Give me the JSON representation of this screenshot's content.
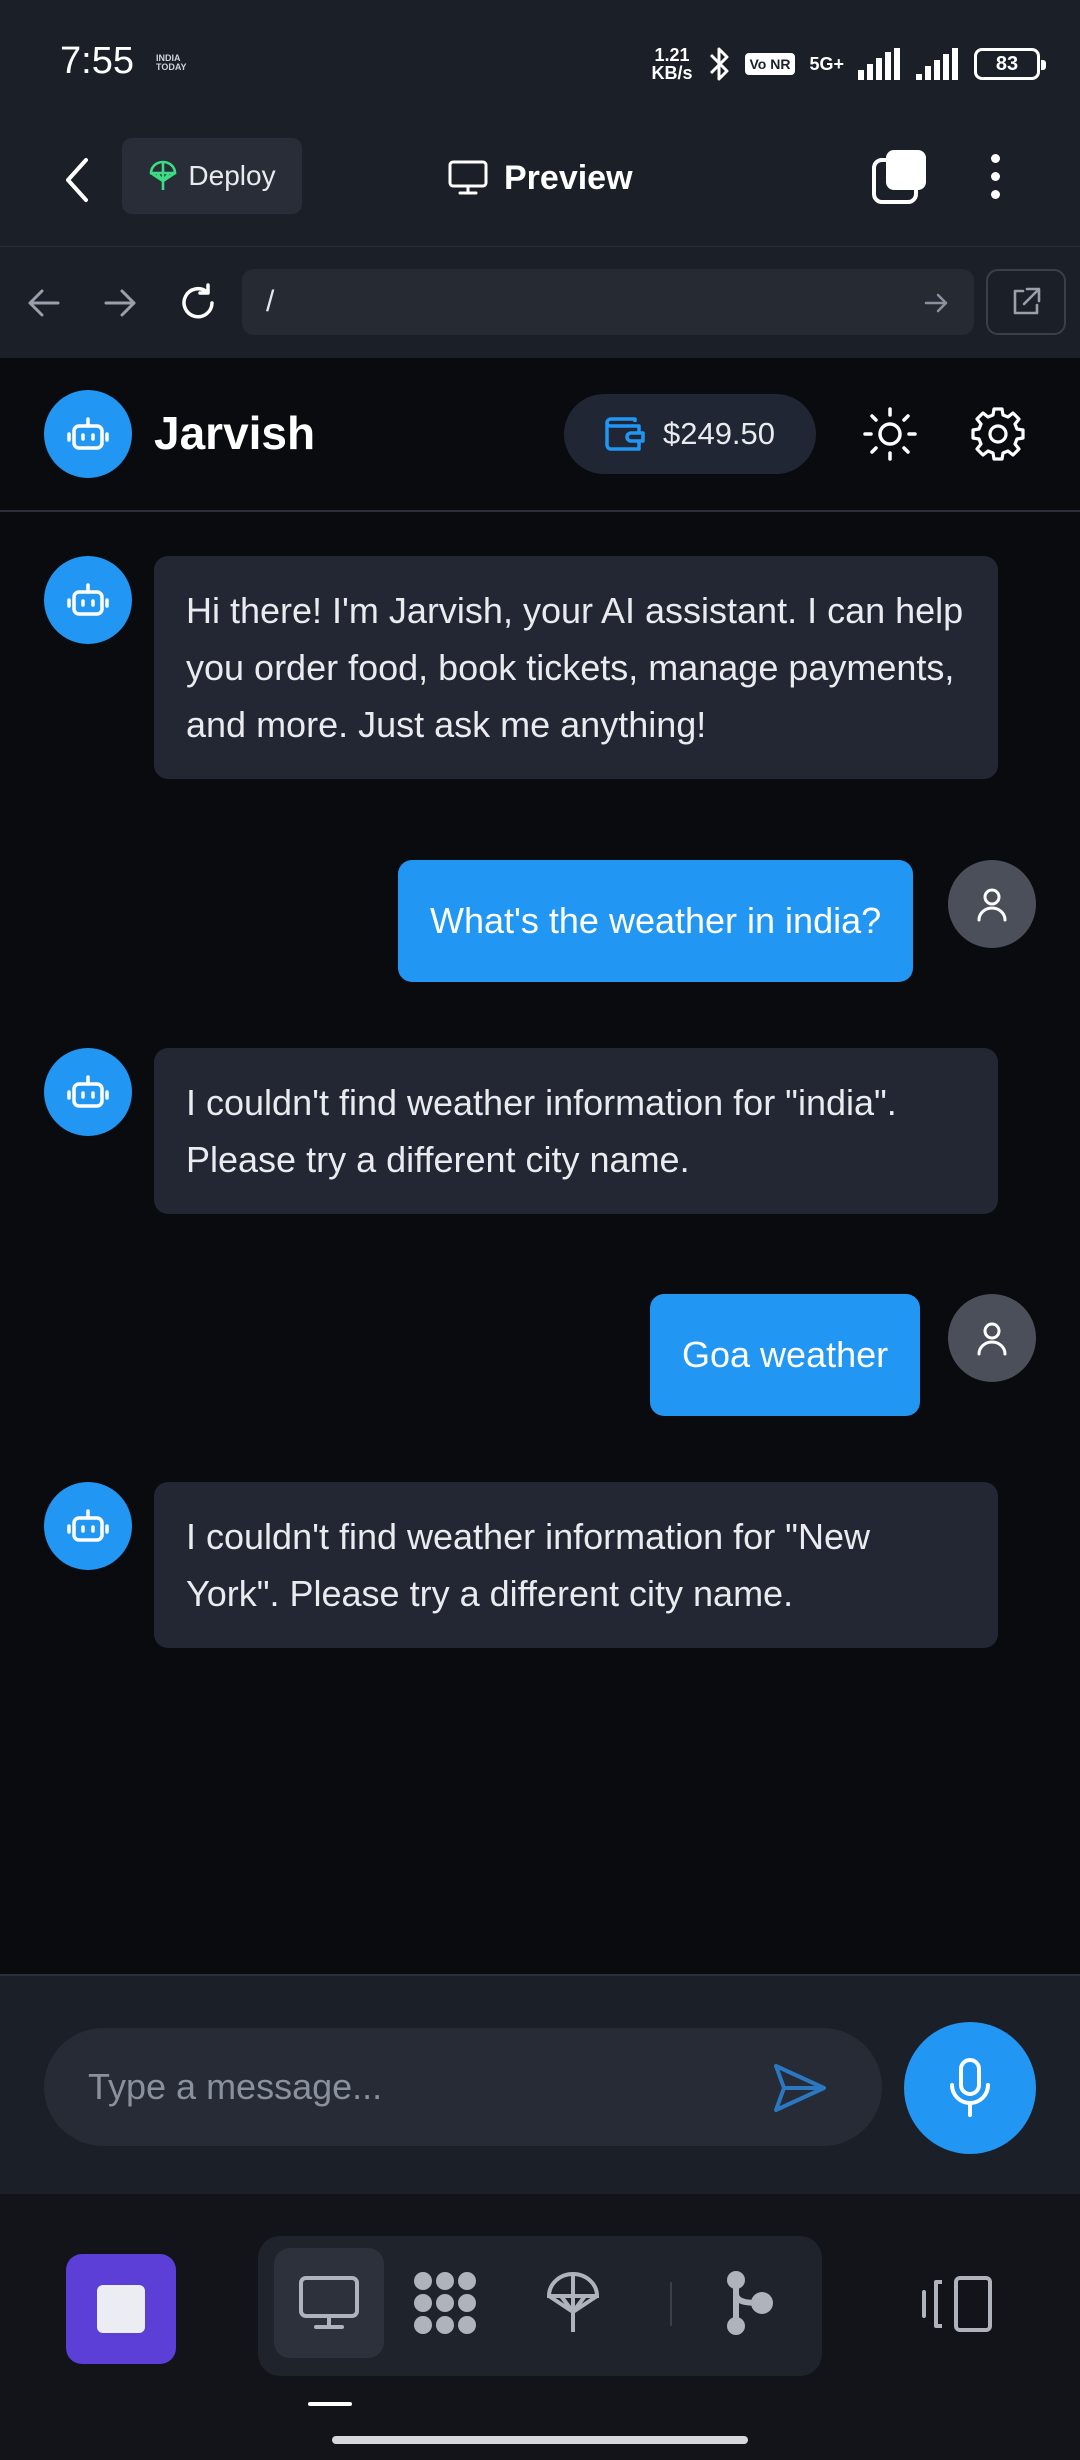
{
  "status_bar": {
    "time": "7:55",
    "logo_line1": "INDIA",
    "logo_line2": "TODAY",
    "speed_value": "1.21",
    "speed_unit": "KB/s",
    "volte": "Vo NR",
    "network": "5G+",
    "battery": "83"
  },
  "app_bar": {
    "deploy_label": "Deploy",
    "preview_label": "Preview"
  },
  "browser": {
    "url": "/"
  },
  "chat_header": {
    "title": "Jarvish",
    "balance": "$249.50"
  },
  "messages": [
    {
      "role": "bot",
      "text": "Hi there! I'm Jarvish, your AI assistant. I can help you order food, book tickets, manage payments, and more. Just ask me anything!"
    },
    {
      "role": "user",
      "text": "What's the weather in india?"
    },
    {
      "role": "bot",
      "text": "I couldn't find weather information for \"india\". Please try a different city name."
    },
    {
      "role": "user",
      "text": "Goa weather"
    },
    {
      "role": "bot",
      "text": "I couldn't find weather information for \"New York\". Please try a different city name."
    }
  ],
  "composer": {
    "placeholder": "Type a message...",
    "value": ""
  },
  "icons": {
    "bot": "robot-icon",
    "user": "user-icon",
    "send": "send-icon",
    "mic": "microphone-icon",
    "wallet": "wallet-icon",
    "theme": "sun-icon",
    "settings": "gear-icon"
  },
  "colors": {
    "accent": "#2196f3",
    "background": "#0a0b0e",
    "surface": "#1b1f28",
    "bot_bubble": "#222733",
    "stop_button": "#5b3fd6",
    "deploy_icon": "#3ddc84"
  }
}
